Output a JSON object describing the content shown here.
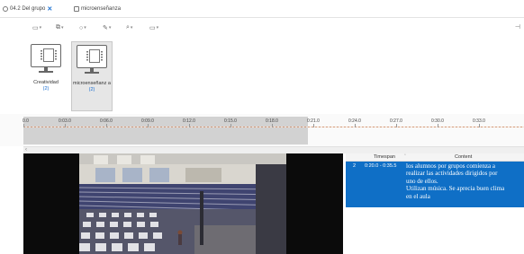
{
  "tabs": [
    {
      "label": "04.2 Del grupo",
      "closable": true
    },
    {
      "label": "microenseñanza"
    }
  ],
  "toolbar": {
    "items": [
      "view-icon",
      "filter-icon",
      "shape-icon",
      "pen-icon",
      "zoom-icon",
      "layout-icon"
    ]
  },
  "gallery": {
    "items": [
      {
        "name": "Creatividad",
        "count": "(2)",
        "selected": false
      },
      {
        "name": "microenseñanz a",
        "count": "(2)",
        "selected": true
      }
    ]
  },
  "timeline": {
    "ticks": [
      "0.0",
      "0:03.0",
      "0:06.0",
      "0:09.0",
      "0:12.0",
      "0:15.0",
      "0:18.0",
      "0:21.0",
      "0:24.0",
      "0:27.0",
      "0:30.0",
      "0:33.0"
    ]
  },
  "table": {
    "headers": {
      "timespan": "Timespan",
      "content": "Content"
    },
    "rows": [
      {
        "index": "2",
        "timespan": "0:20.0 - 0:35.5",
        "content_lines": [
          "los alumnos por grupos comienza a",
          "realizar las actividades dirigidos por",
          "uno de ellos.",
          "Utilizan música. Se aprecia buen clima",
          "en el aula"
        ]
      }
    ]
  },
  "colors": {
    "selection": "#0f6fc6",
    "link": "#1a6fd1",
    "timeline_played": "#d2d2d2"
  }
}
